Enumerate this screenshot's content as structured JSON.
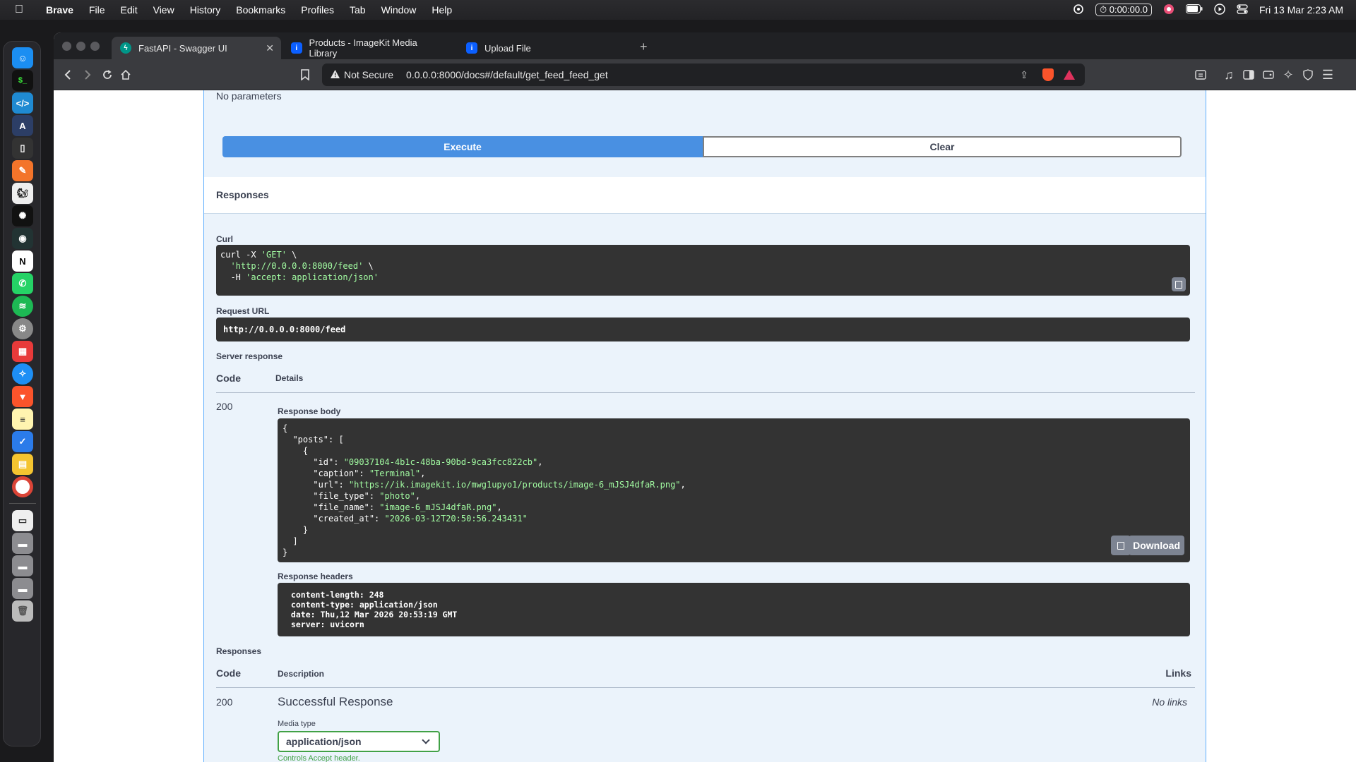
{
  "menubar": {
    "app": "Brave",
    "items": [
      "File",
      "Edit",
      "View",
      "History",
      "Bookmarks",
      "Profiles",
      "Tab",
      "Window",
      "Help"
    ],
    "timer": "0:00:00.0",
    "datetime": "Fri 13 Mar  2:23 AM"
  },
  "tabs": [
    {
      "label": "FastAPI - Swagger UI",
      "active": true
    },
    {
      "label": "Products - ImageKit Media Library",
      "active": false
    },
    {
      "label": "Upload File",
      "active": false
    }
  ],
  "address": {
    "security": "Not Secure",
    "url": "0.0.0.0:8000/docs#/default/get_feed_feed_get"
  },
  "swagger": {
    "no_parameters": "No parameters",
    "execute": "Execute",
    "clear": "Clear",
    "responses_heading": "Responses",
    "curl_label": "Curl",
    "curl_lines": [
      "curl -X 'GET' \\",
      "  'http://0.0.0.0:8000/feed' \\",
      "  -H 'accept: application/json'"
    ],
    "request_url_label": "Request URL",
    "request_url": "http://0.0.0.0:8000/feed",
    "server_response_label": "Server response",
    "code_header": "Code",
    "details_header": "Details",
    "status_code": "200",
    "response_body_label": "Response body",
    "response_body_lines": [
      "{",
      "  \"posts\": [",
      "    {",
      "      \"id\": \"09037104-4b1c-48ba-90bd-9ca3fcc822cb\",",
      "      \"caption\": \"Terminal\",",
      "      \"url\": \"https://ik.imagekit.io/mwg1upyo1/products/image-6_mJSJ4dfaR.png\",",
      "      \"file_type\": \"photo\",",
      "      \"file_name\": \"image-6_mJSJ4dfaR.png\",",
      "      \"created_at\": \"2026-03-12T20:50:56.243431\"",
      "    }",
      "  ]",
      "}"
    ],
    "download": "Download",
    "response_headers_label": "Response headers",
    "response_headers_lines": [
      " content-length: 248 ",
      " content-type: application/json ",
      " date: Thu,12 Mar 2026 20:53:19 GMT ",
      " server: uvicorn "
    ],
    "responses_label": "Responses",
    "description_header": "Description",
    "links_header": "Links",
    "resp_code": "200",
    "resp_description": "Successful Response",
    "no_links": "No links",
    "media_type_label": "Media type",
    "media_type_value": "application/json",
    "controls_accept": "Controls Accept header."
  }
}
